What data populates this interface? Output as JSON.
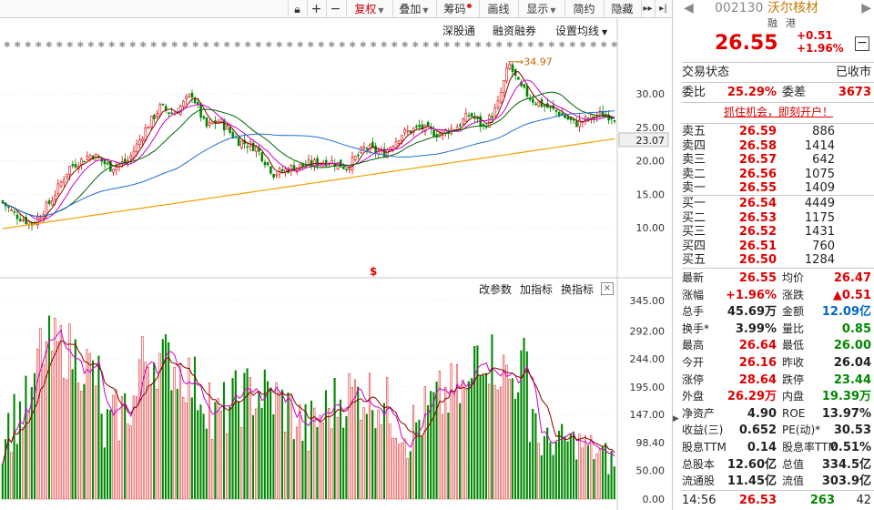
{
  "toolbar": {
    "restore": "复权",
    "overlay": "叠加",
    "chips": "筹码",
    "draw": "画线",
    "display": "显示",
    "simple": "简约",
    "hide": "隐藏"
  },
  "top_links": {
    "shsz_connect": "深股通",
    "margin": "融资融券",
    "set_ma": "设置均线"
  },
  "price_axis": {
    "ticks": [
      "30.00",
      "25.00",
      "20.00",
      "15.00",
      "10.00"
    ],
    "current_label": "23.07"
  },
  "annotations": {
    "peak_label": "34.97",
    "marker_symbol": "$"
  },
  "volume_panel": {
    "change_params": "改参数",
    "add_indicator": "加指标",
    "switch_indicator": "换指标",
    "close_symbol": "×",
    "ticks": [
      "345.00",
      "292.00",
      "244.00",
      "195.00",
      "147.00",
      "98.40",
      "50.00",
      "0.00"
    ]
  },
  "quote": {
    "code": "002130",
    "name": "沃尔核材",
    "tag_margin": "融",
    "tag_hk": "港",
    "price": "26.55",
    "change": "+0.51",
    "change_pct": "+1.96%",
    "minus_symbol": "−",
    "trade_status_label": "交易状态",
    "trade_status": "已收市",
    "weibi_label": "委比",
    "weibi": "25.29%",
    "weicha_label": "委差",
    "weicha": "3673",
    "promo": "抓住机会，即刻开户！",
    "asks": [
      {
        "label": "卖五",
        "price": "26.59",
        "vol": "886"
      },
      {
        "label": "卖四",
        "price": "26.58",
        "vol": "1414"
      },
      {
        "label": "卖三",
        "price": "26.57",
        "vol": "642"
      },
      {
        "label": "卖二",
        "price": "26.56",
        "vol": "1075"
      },
      {
        "label": "卖一",
        "price": "26.55",
        "vol": "1409"
      }
    ],
    "bids": [
      {
        "label": "买一",
        "price": "26.54",
        "vol": "4449"
      },
      {
        "label": "买二",
        "price": "26.53",
        "vol": "1175"
      },
      {
        "label": "买三",
        "price": "26.52",
        "vol": "1431"
      },
      {
        "label": "买四",
        "price": "26.51",
        "vol": "760"
      },
      {
        "label": "买五",
        "price": "26.50",
        "vol": "1284"
      }
    ],
    "stats": [
      {
        "l1": "最新",
        "v1": "26.55",
        "c1": "red",
        "l2": "均价",
        "v2": "26.47",
        "c2": "red"
      },
      {
        "l1": "涨幅",
        "v1": "+1.96%",
        "c1": "red",
        "l2": "涨跌",
        "v2": "▲0.51",
        "c2": "red"
      },
      {
        "l1": "总手",
        "v1": "45.69万",
        "c1": "",
        "l2": "金额",
        "v2": "12.09亿",
        "c2": "blue"
      },
      {
        "l1": "换手*",
        "v1": "3.99%",
        "c1": "",
        "l2": "量比",
        "v2": "0.85",
        "c2": "green"
      },
      {
        "l1": "最高",
        "v1": "26.64",
        "c1": "red",
        "l2": "最低",
        "v2": "26.00",
        "c2": "green"
      },
      {
        "l1": "今开",
        "v1": "26.16",
        "c1": "red",
        "l2": "昨收",
        "v2": "26.04",
        "c2": ""
      },
      {
        "l1": "涨停",
        "v1": "28.64",
        "c1": "red",
        "l2": "跌停",
        "v2": "23.44",
        "c2": "green"
      },
      {
        "l1": "外盘",
        "v1": "26.29万",
        "c1": "red",
        "l2": "内盘",
        "v2": "19.39万",
        "c2": "green"
      },
      {
        "l1": "净资产",
        "v1": "4.90",
        "c1": "",
        "l2": "ROE",
        "v2": "13.97%",
        "c2": ""
      },
      {
        "l1": "收益(三)",
        "v1": "0.652",
        "c1": "",
        "l2": "PE(动)*",
        "v2": "30.53",
        "c2": ""
      },
      {
        "l1": "股息TTM",
        "v1": "0.14",
        "c1": "",
        "l2": "股息率TTM",
        "v2": "0.51%",
        "c2": ""
      },
      {
        "l1": "总股本",
        "v1": "12.60亿",
        "c1": "",
        "l2": "总值",
        "v2": "334.5亿",
        "c2": ""
      },
      {
        "l1": "流通股",
        "v1": "11.45亿",
        "c1": "",
        "l2": "流值",
        "v2": "303.9亿",
        "c2": ""
      }
    ],
    "tick": {
      "time": "14:56",
      "price": "26.53",
      "vol": "263",
      "count": "42"
    }
  },
  "colors": {
    "up": "#e00000",
    "down": "#008800",
    "ma5": "#8b0000",
    "ma10": "#cc00cc",
    "ma20": "#006400",
    "ma60": "#1f6fd0",
    "ma120": "#f0a000"
  }
}
